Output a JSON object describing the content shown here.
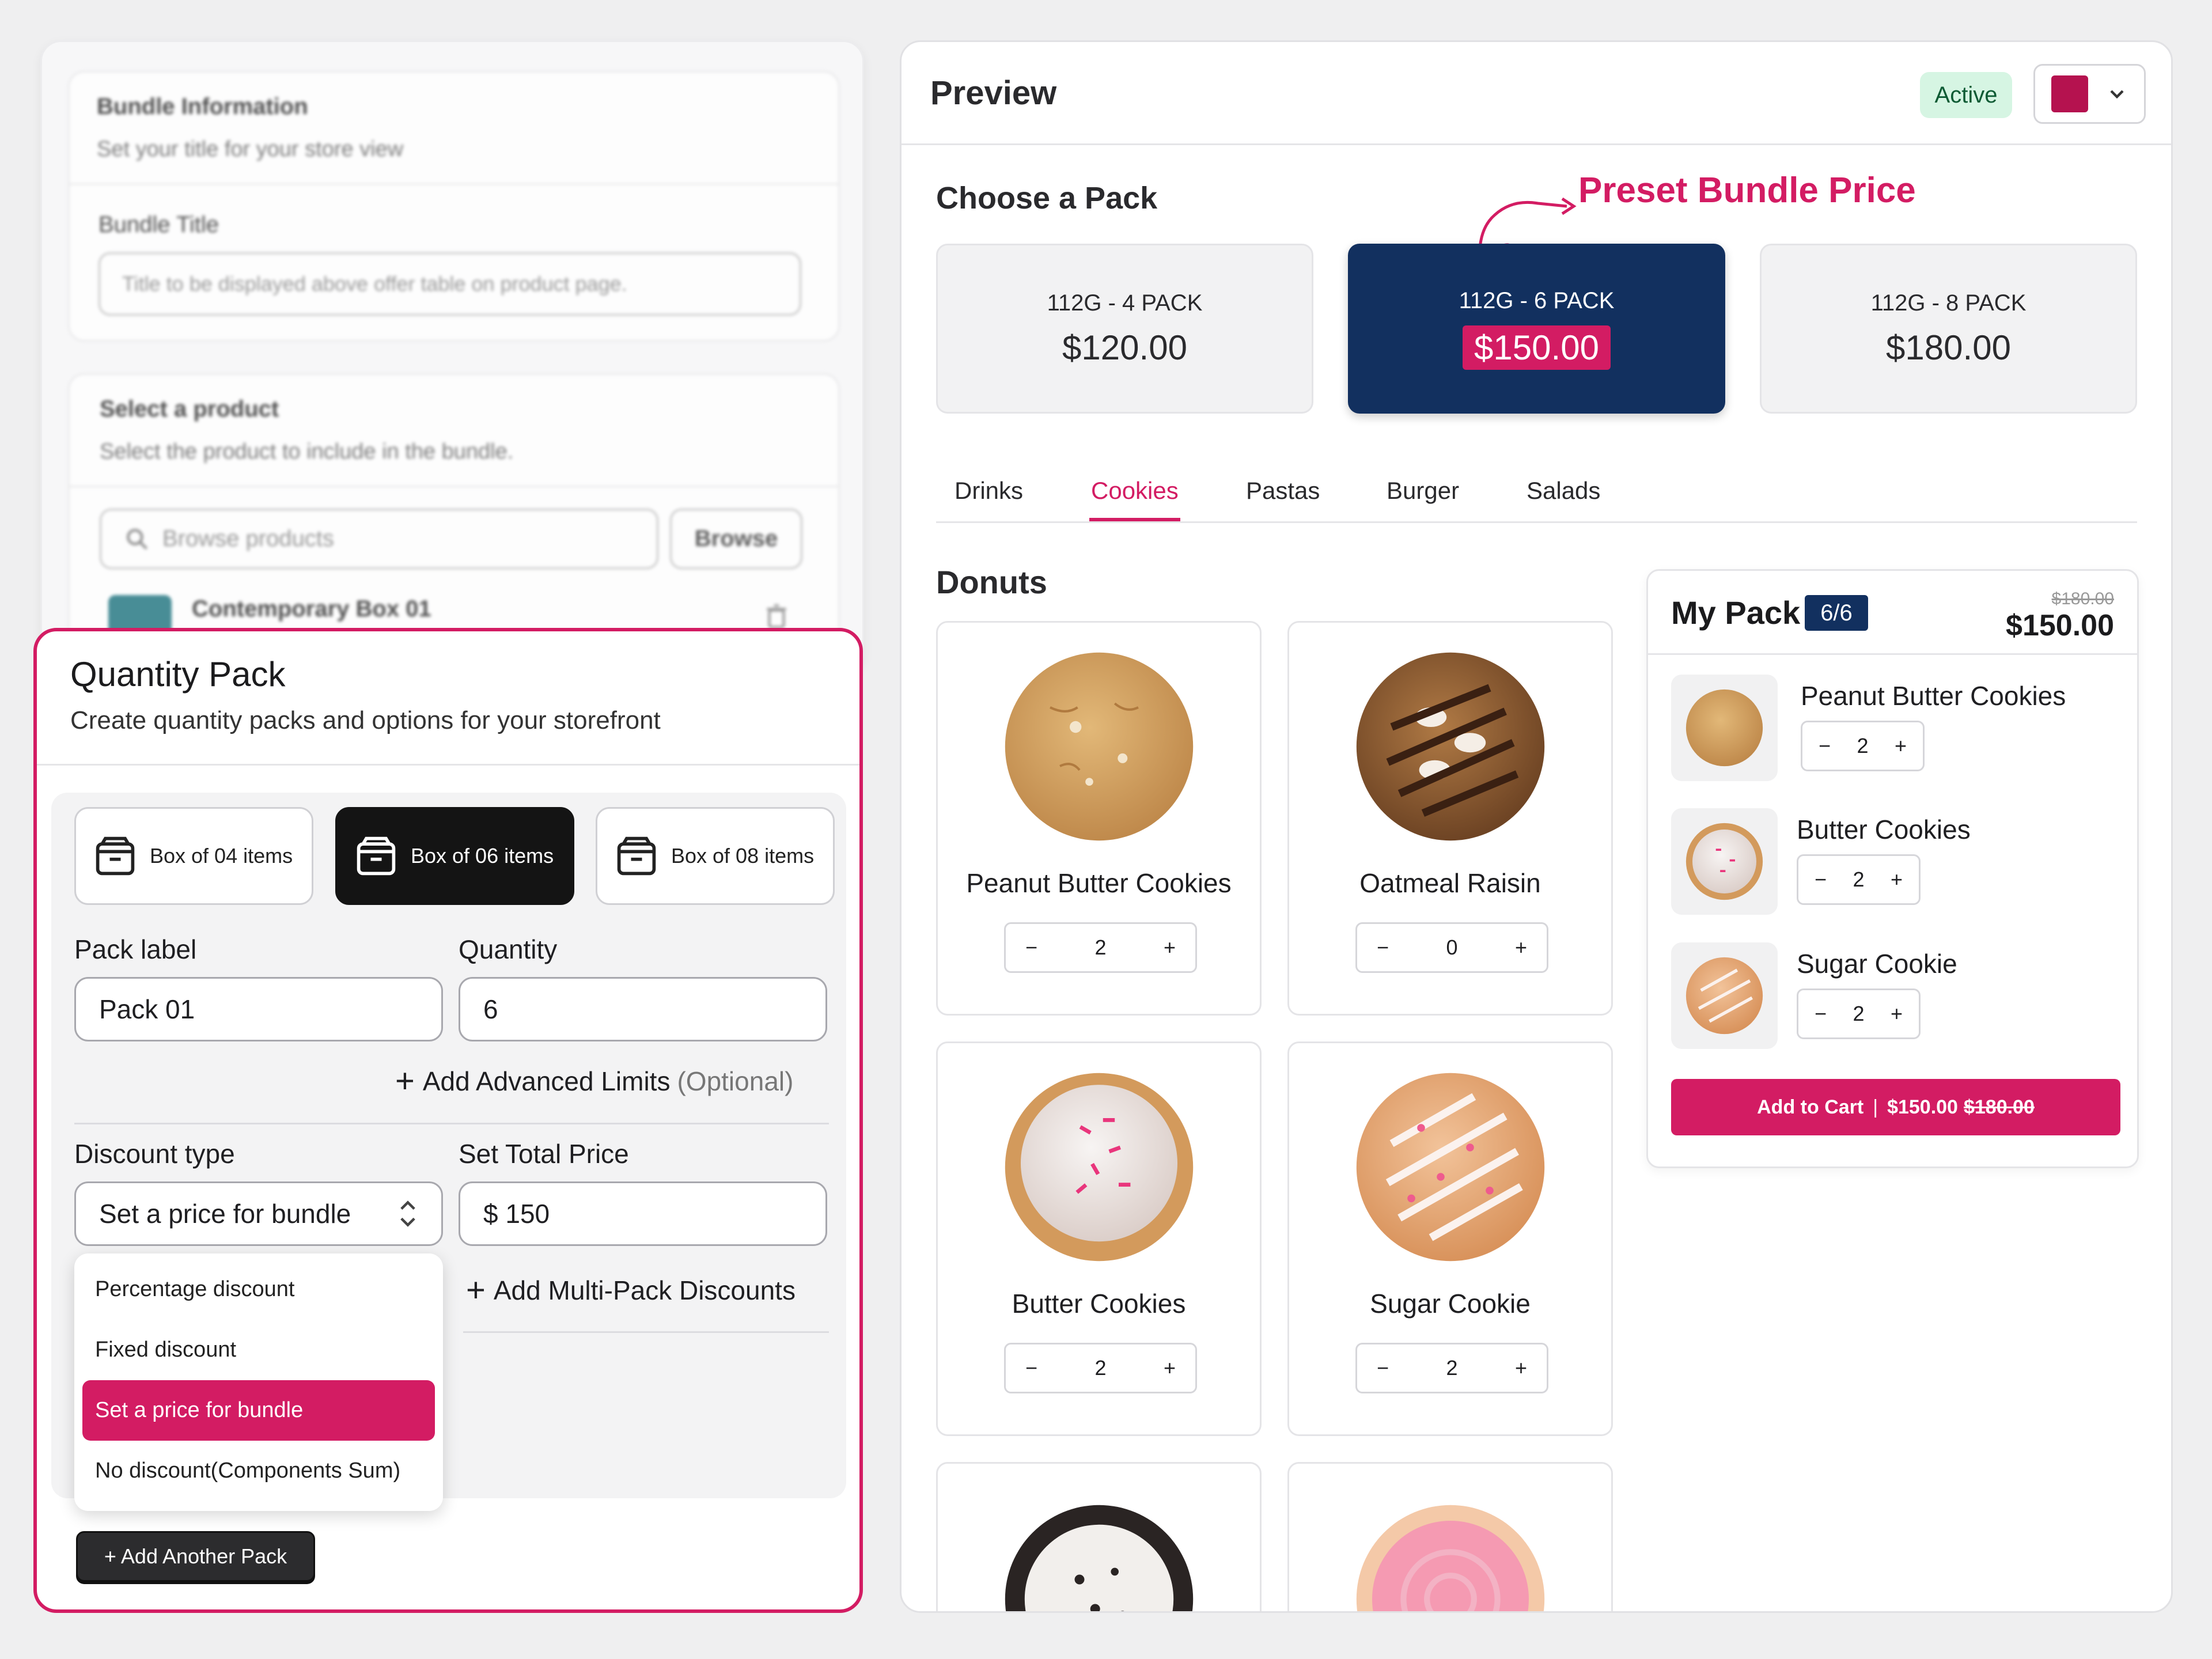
{
  "colors": {
    "accent": "#d31c63",
    "navy": "#12305f",
    "dark": "#111111",
    "active_bg": "#d6f5e3",
    "active_text": "#0d5b34"
  },
  "left": {
    "bundle_info": {
      "title": "Bundle Information",
      "subtitle": "Set your title for your store view",
      "field_label": "Bundle Title",
      "placeholder": "Title to be displayed above offer table on product page."
    },
    "select_product": {
      "title": "Select a product",
      "subtitle": "Select the product to include in the bundle.",
      "search_placeholder": "Browse products",
      "browse_label": "Browse",
      "product_name": "Contemporary Box 01"
    },
    "quantity_pack": {
      "title": "Quantity Pack",
      "subtitle": "Create quantity packs and options for your storefront",
      "boxes": [
        {
          "label": "Box of 04 items"
        },
        {
          "label": "Box of 06 items"
        },
        {
          "label": "Box of 08 items"
        }
      ],
      "pack_label_label": "Pack label",
      "pack_label_value": "Pack 01",
      "quantity_label": "Quantity",
      "quantity_value": "6",
      "advanced_limits": "Add Advanced Limits",
      "optional": "(Optional)",
      "discount_type_label": "Discount type",
      "discount_type_value": "Set a price for bundle",
      "total_price_label": "Set Total Price",
      "total_price_value": "$ 150",
      "multi_pack": "Add Multi-Pack Discounts",
      "dropdown_options": [
        "Percentage discount",
        "Fixed discount",
        "Set a price for bundle",
        "No discount(Components Sum)"
      ],
      "add_another": "+ Add Another Pack"
    }
  },
  "preview": {
    "title": "Preview",
    "status": "Active",
    "color_swatch": "#b5124f",
    "choose_pack": "Choose a Pack",
    "annotation": "Preset Bundle Price",
    "packs": [
      {
        "label": "112G - 4 PACK",
        "price": "$120.00"
      },
      {
        "label": "112G - 6 PACK",
        "price": "$150.00"
      },
      {
        "label": "112G - 8 PACK",
        "price": "$180.00"
      }
    ],
    "tabs": [
      "Drinks",
      "Cookies",
      "Pastas",
      "Burger",
      "Salads"
    ],
    "section": "Donuts",
    "products": [
      {
        "name": "Peanut Butter Cookies",
        "qty": "2",
        "icon": "peanut-butter-cookie-image"
      },
      {
        "name": "Oatmeal Raisin",
        "qty": "0",
        "icon": "oatmeal-raisin-cookie-image"
      },
      {
        "name": "Butter Cookies",
        "qty": "2",
        "icon": "butter-cookie-image"
      },
      {
        "name": "Sugar Cookie",
        "qty": "2",
        "icon": "sugar-cookie-image"
      }
    ],
    "my_pack": {
      "title": "My Pack",
      "count": "6/6",
      "old_price": "$180.00",
      "price": "$150.00",
      "items": [
        {
          "name": "Peanut Butter Cookies",
          "qty": "2"
        },
        {
          "name": "Butter Cookies",
          "qty": "2"
        },
        {
          "name": "Sugar Cookie",
          "qty": "2"
        }
      ],
      "cart_label": "Add to Cart",
      "cart_price": "$150.00",
      "cart_old_price": "$180.00"
    }
  }
}
